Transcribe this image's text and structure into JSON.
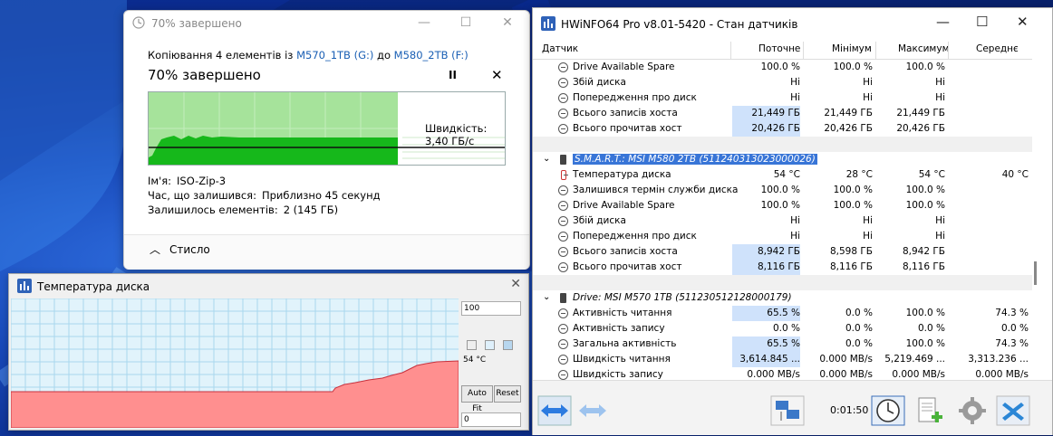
{
  "copy_dialog": {
    "title": "70% завершено",
    "desc_prefix": "Копіювання 4 елементів із",
    "source": "M570_1TB (G:)",
    "desc_mid": "до",
    "destination": "M580_2TB (F:)",
    "status": "70% завершено",
    "progress_fraction": 0.7,
    "speed": "Швидкість: 3,40 ГБ/с",
    "name_label": "Ім'я:",
    "name_value": "ISO-Zip-3",
    "time_label": "Час, що залишився:",
    "time_value": "Приблизно 45 секунд",
    "items_label": "Залишилось елементів:",
    "items_value": "2 (145 ГБ)",
    "collapse_label": "Стисло",
    "pause_glyph": "II",
    "close_glyph": "✕"
  },
  "temp_window": {
    "title": "Температура диска",
    "max_value": "100",
    "current": "54 °C",
    "min_value": "0",
    "autofit_label": "Auto Fit",
    "reset_label": "Reset",
    "close_glyph": "✕"
  },
  "hwinfo": {
    "title": "HWiNFO64 Pro v8.01-5420 - Стан датчиків",
    "columns": [
      "Датчик",
      "Поточне",
      "Мінімум",
      "Максимум",
      "Середнє"
    ],
    "rows": [
      {
        "type": "item",
        "name": "Drive Available Spare",
        "cur": "100.0 %",
        "min": "100.0 %",
        "max": "100.0 %",
        "avg": "",
        "hl": false
      },
      {
        "type": "item",
        "name": "Збій диска",
        "cur": "Ні",
        "min": "Ні",
        "max": "Ні",
        "avg": "",
        "hl": false
      },
      {
        "type": "item",
        "name": "Попередження про диск",
        "cur": "Ні",
        "min": "Ні",
        "max": "Ні",
        "avg": "",
        "hl": false
      },
      {
        "type": "item",
        "name": "Всього записів хоста",
        "cur": "21,449 ГБ",
        "min": "21,449 ГБ",
        "max": "21,449 ГБ",
        "avg": "",
        "hl": true
      },
      {
        "type": "item",
        "name": "Всього прочитав хост",
        "cur": "20,426 ГБ",
        "min": "20,426 ГБ",
        "max": "20,426 ГБ",
        "avg": "",
        "hl": true
      },
      {
        "type": "spacer"
      },
      {
        "type": "group",
        "name": "S.M.A.R.T.: MSI M580 2TB (511240313023000026)",
        "selected": true
      },
      {
        "type": "temp",
        "name": "Температура диска",
        "cur": "54 °C",
        "min": "28 °C",
        "max": "54 °C",
        "avg": "40 °C",
        "hl": false
      },
      {
        "type": "item",
        "name": "Залишився термін служби диска",
        "cur": "100.0 %",
        "min": "100.0 %",
        "max": "100.0 %",
        "avg": "",
        "hl": false
      },
      {
        "type": "item",
        "name": "Drive Available Spare",
        "cur": "100.0 %",
        "min": "100.0 %",
        "max": "100.0 %",
        "avg": "",
        "hl": false
      },
      {
        "type": "item",
        "name": "Збій диска",
        "cur": "Ні",
        "min": "Ні",
        "max": "Ні",
        "avg": "",
        "hl": false
      },
      {
        "type": "item",
        "name": "Попередження про диск",
        "cur": "Ні",
        "min": "Ні",
        "max": "Ні",
        "avg": "",
        "hl": false
      },
      {
        "type": "item",
        "name": "Всього записів хоста",
        "cur": "8,942 ГБ",
        "min": "8,598 ГБ",
        "max": "8,942 ГБ",
        "avg": "",
        "hl": true
      },
      {
        "type": "item",
        "name": "Всього прочитав хост",
        "cur": "8,116 ГБ",
        "min": "8,116 ГБ",
        "max": "8,116 ГБ",
        "avg": "",
        "hl": true
      },
      {
        "type": "spacer"
      },
      {
        "type": "group",
        "name": "Drive: MSI M570 1TB (511230512128000179)",
        "selected": false
      },
      {
        "type": "item",
        "name": "Активність читання",
        "cur": "65.5 %",
        "min": "0.0 %",
        "max": "100.0 %",
        "avg": "74.3 %",
        "hl": true
      },
      {
        "type": "item",
        "name": "Активність запису",
        "cur": "0.0 %",
        "min": "0.0 %",
        "max": "0.0 %",
        "avg": "0.0 %",
        "hl": false
      },
      {
        "type": "item",
        "name": "Загальна активність",
        "cur": "65.5 %",
        "min": "0.0 %",
        "max": "100.0 %",
        "avg": "74.3 %",
        "hl": true
      },
      {
        "type": "item",
        "name": "Швидкість читання",
        "cur": "3,614.845 ...",
        "min": "0.000 MB/s",
        "max": "5,219.469 ...",
        "avg": "3,313.236 ...",
        "hl": true
      },
      {
        "type": "item",
        "name": "Швидкість запису",
        "cur": "0.000 MB/s",
        "min": "0.000 MB/s",
        "max": "0.000 MB/s",
        "avg": "0.000 MB/s",
        "hl": false
      }
    ],
    "timer": "0:01:50"
  }
}
